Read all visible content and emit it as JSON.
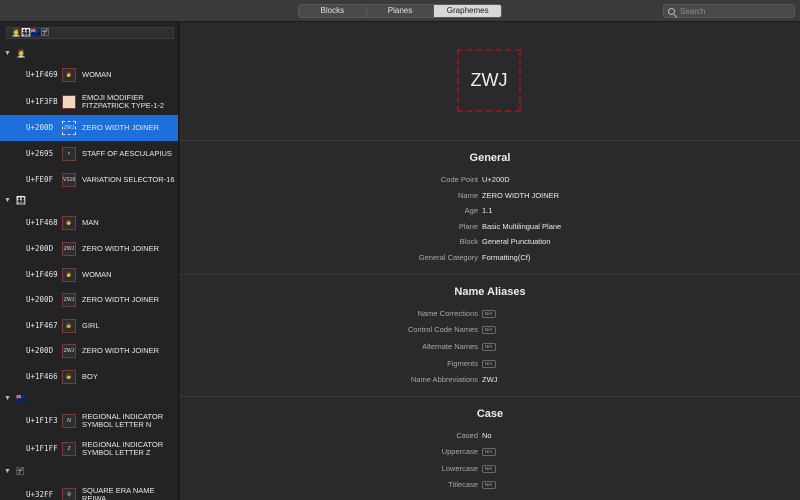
{
  "toolbar": {
    "tabs": [
      {
        "label": "Blocks"
      },
      {
        "label": "Planes"
      },
      {
        "label": "Graphemes"
      }
    ],
    "active_tab": "Graphemes",
    "search_placeholder": "Search"
  },
  "sidebar": {
    "input_value": "👩‍⚕️👨‍👩‍👧‍👦🇳🇿🈓",
    "groups": [
      {
        "glyph": "👩‍⚕️"
      },
      {
        "glyph": "👨‍👩‍👧‍👦"
      },
      {
        "glyph": "🇳🇿"
      },
      {
        "glyph": "🈓"
      }
    ],
    "rows": [
      {
        "cp": "U+1F469",
        "box": "👩",
        "name": "WOMAN"
      },
      {
        "cp": "U+1F3FB",
        "box": "",
        "name": "EMOJI MODIFIER FITZPATRICK TYPE-1-2"
      },
      {
        "cp": "U+200D",
        "box": "ZWJ",
        "name": "ZERO WIDTH JOINER"
      },
      {
        "cp": "U+2695",
        "box": "⚕",
        "name": "STAFF OF AESCULAPIUS"
      },
      {
        "cp": "U+FE0F",
        "box": "VS16",
        "name": "VARIATION SELECTOR-16"
      },
      {
        "cp": "U+1F468",
        "box": "👨",
        "name": "MAN"
      },
      {
        "cp": "U+200D",
        "box": "ZWJ",
        "name": "ZERO WIDTH JOINER"
      },
      {
        "cp": "U+1F469",
        "box": "👩",
        "name": "WOMAN"
      },
      {
        "cp": "U+200D",
        "box": "ZWJ",
        "name": "ZERO WIDTH JOINER"
      },
      {
        "cp": "U+1F467",
        "box": "👧",
        "name": "GIRL"
      },
      {
        "cp": "U+200D",
        "box": "ZWJ",
        "name": "ZERO WIDTH JOINER"
      },
      {
        "cp": "U+1F466",
        "box": "👦",
        "name": "BOY"
      },
      {
        "cp": "U+1F1F3",
        "box": "N",
        "name": "REGIONAL INDICATOR SYMBOL LETTER N"
      },
      {
        "cp": "U+1F1FF",
        "box": "Z",
        "name": "REGIONAL INDICATOR SYMBOL LETTER Z"
      },
      {
        "cp": "U+32FF",
        "box": "令",
        "name": "SQUARE ERA NAME REIWA"
      }
    ],
    "selected_row": "U+200D ZERO WIDTH JOINER"
  },
  "detail": {
    "glyph": "ZWJ",
    "general": {
      "title": "General",
      "props": [
        {
          "k": "Code Point",
          "v": "U+200D"
        },
        {
          "k": "Name",
          "v": "ZERO WIDTH JOINER"
        },
        {
          "k": "Age",
          "v": "1.1"
        },
        {
          "k": "Plane",
          "v": "Basic Multilingual Plane"
        },
        {
          "k": "Block",
          "v": "General Punctuation"
        },
        {
          "k": "General Category",
          "v": "Formatting(Cf)"
        }
      ]
    },
    "aliases": {
      "title": "Name Aliases",
      "props": [
        {
          "k": "Name Corrections",
          "v": "N/A"
        },
        {
          "k": "Control Code Names",
          "v": "N/A"
        },
        {
          "k": "Alternate Names",
          "v": "N/A"
        },
        {
          "k": "Figments",
          "v": "N/A"
        },
        {
          "k": "Name Abbreviations",
          "v": "ZWJ"
        }
      ]
    },
    "case": {
      "title": "Case",
      "props": [
        {
          "k": "Cased",
          "v": "No"
        },
        {
          "k": "Uppercase",
          "v": "N/A"
        },
        {
          "k": "Lowercase",
          "v": "N/A"
        },
        {
          "k": "Titlecase",
          "v": "N/A"
        }
      ]
    }
  },
  "colors": {
    "selection": "#1d6fdb",
    "zwj_border": "#8b1a1a"
  }
}
